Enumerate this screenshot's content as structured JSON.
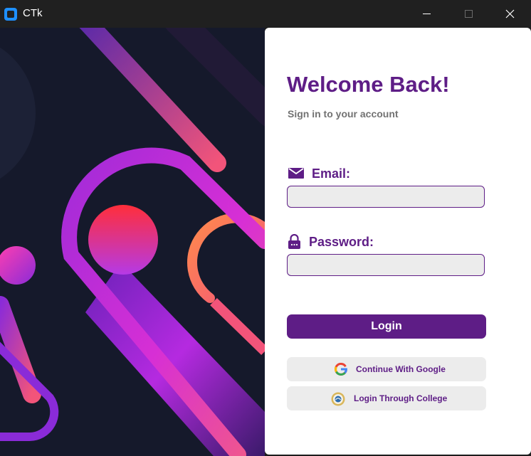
{
  "window": {
    "title": "CTk",
    "controls": [
      "minimize-icon",
      "maximize-icon",
      "close-icon"
    ]
  },
  "illustration": {
    "description_icon": "abstract-gradient-shapes",
    "colors": {
      "background": "#15192b",
      "purple": "#b52ae0",
      "pink": "#f2547a",
      "orange": "#ff8a4c"
    }
  },
  "login": {
    "heading": "Welcome Back!",
    "subheading": "Sign in to your account",
    "email_label": "Email:",
    "email_icon": "mail-icon",
    "email_value": "",
    "password_label": "Password:",
    "password_icon": "lock-icon",
    "password_value": "",
    "login_button": "Login",
    "google_button": "Continue With Google",
    "google_icon": "google-icon",
    "college_button": "Login Through College",
    "college_icon": "college-seal-icon"
  },
  "colors": {
    "accent": "#5e1d86",
    "field_bg": "#ececec",
    "subtext": "#727272"
  }
}
